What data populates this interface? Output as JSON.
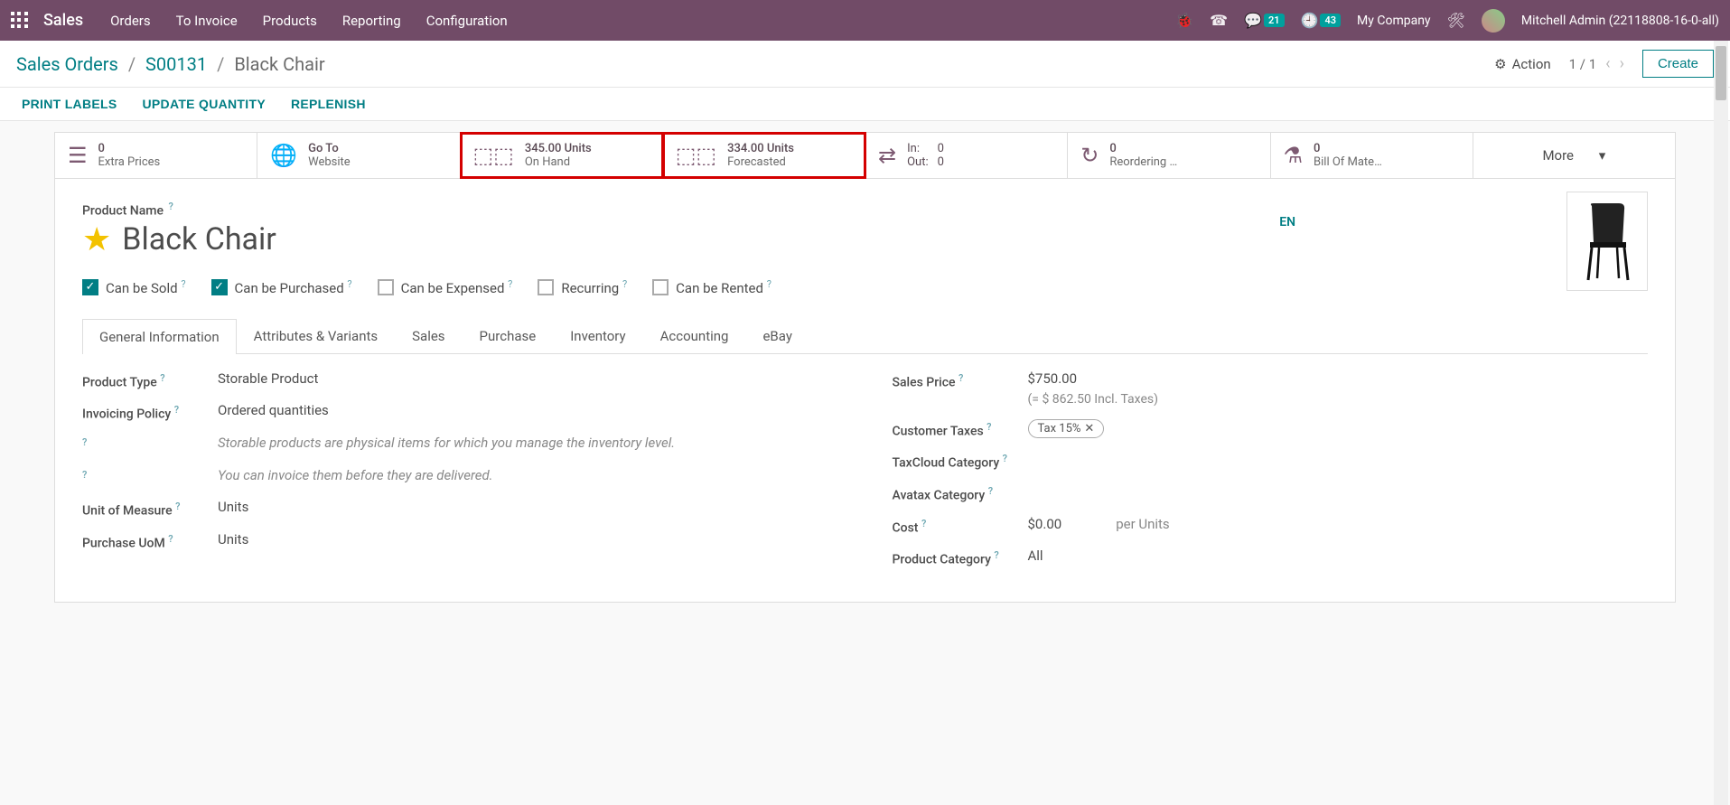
{
  "nav": {
    "brand": "Sales",
    "menu": [
      "Orders",
      "To Invoice",
      "Products",
      "Reporting",
      "Configuration"
    ],
    "messages_badge": "21",
    "activities_badge": "43",
    "company": "My Company",
    "user": "Mitchell Admin (22118808-16-0-all)"
  },
  "breadcrumb": {
    "root": "Sales Orders",
    "mid": "S00131",
    "leaf": "Black Chair"
  },
  "controls": {
    "action": "Action",
    "pager": "1 / 1",
    "create": "Create"
  },
  "actions": {
    "print_labels": "PRINT LABELS",
    "update_qty": "UPDATE QUANTITY",
    "replenish": "REPLENISH"
  },
  "stats": {
    "extra": {
      "line1": "0",
      "line2": "Extra Prices"
    },
    "website": {
      "line1": "Go To",
      "line2": "Website"
    },
    "onhand": {
      "line1": "345.00 Units",
      "line2": "On Hand"
    },
    "forecast": {
      "line1": "334.00 Units",
      "line2": "Forecasted"
    },
    "inout": {
      "in_label": "In:",
      "in_val": "0",
      "out_label": "Out:",
      "out_val": "0"
    },
    "reorder": {
      "line1": "0",
      "line2": "Reordering …"
    },
    "bom": {
      "line1": "0",
      "line2": "Bill Of Mate…"
    },
    "more": "More"
  },
  "product": {
    "name_label": "Product Name",
    "name": "Black Chair",
    "lang": "EN",
    "can_be_sold": "Can be Sold",
    "can_be_purchased": "Can be Purchased",
    "can_be_expensed": "Can be Expensed",
    "recurring": "Recurring",
    "can_be_rented": "Can be Rented"
  },
  "tabs": [
    "General Information",
    "Attributes & Variants",
    "Sales",
    "Purchase",
    "Inventory",
    "Accounting",
    "eBay"
  ],
  "left": {
    "product_type_label": "Product Type",
    "product_type": "Storable Product",
    "invoicing_label": "Invoicing Policy",
    "invoicing": "Ordered quantities",
    "help1": "Storable products are physical items for which you manage the inventory level.",
    "help2": "You can invoice them before they are delivered.",
    "uom_label": "Unit of Measure",
    "uom": "Units",
    "puom_label": "Purchase UoM",
    "puom": "Units"
  },
  "right": {
    "price_label": "Sales Price",
    "price": "$750.00",
    "price_incl": "(= $ 862.50 Incl. Taxes)",
    "taxes_label": "Customer Taxes",
    "tax_chip": "Tax 15%",
    "taxcloud_label": "TaxCloud Category",
    "avatax_label": "Avatax Category",
    "cost_label": "Cost",
    "cost": "$0.00",
    "cost_unit": "per Units",
    "cat_label": "Product Category",
    "cat": "All"
  }
}
